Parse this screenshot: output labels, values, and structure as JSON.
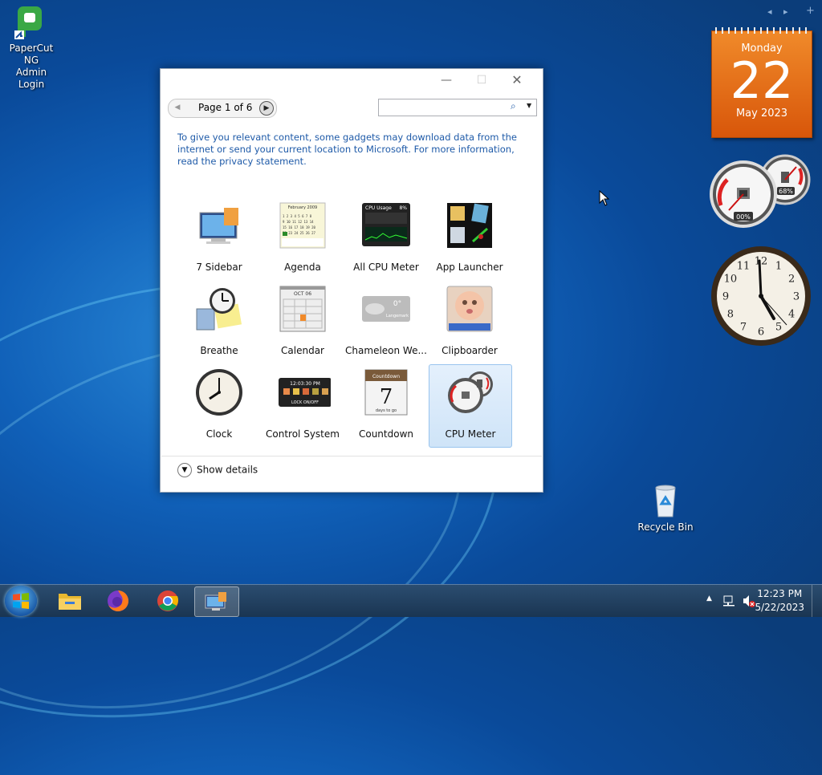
{
  "desktop": {
    "icons": [
      {
        "label_line1": "PaperCut NG",
        "label_line2": "Admin Login"
      },
      {
        "label_line1": "Recycle Bin"
      }
    ]
  },
  "calendar_gadget": {
    "day_name": "Monday",
    "day_number": "22",
    "month_year": "May 2023"
  },
  "cpu_gadget": {
    "cpu_percent": "00%",
    "mem_percent": "68%"
  },
  "clock_gadget": {
    "numerals": [
      "12",
      "1",
      "2",
      "3",
      "4",
      "5",
      "6",
      "7",
      "8",
      "9",
      "10",
      "11"
    ]
  },
  "gadget_window": {
    "page_label": "Page 1 of 6",
    "search_placeholder": "",
    "info_text": "To give you relevant content, some gadgets may download data from the internet or send your current location to Microsoft. For more information, read the privacy statement.",
    "gadgets": [
      {
        "name": "7 Sidebar",
        "icon": "sidebar-icon"
      },
      {
        "name": "Agenda",
        "icon": "agenda-icon"
      },
      {
        "name": "All CPU Meter",
        "icon": "cpu-usage-icon"
      },
      {
        "name": "App Launcher",
        "icon": "app-launcher-icon"
      },
      {
        "name": "Breathe",
        "icon": "breathe-icon"
      },
      {
        "name": "Calendar",
        "icon": "calendar-icon"
      },
      {
        "name": "Chameleon We...",
        "icon": "weather-icon"
      },
      {
        "name": "Clipboarder",
        "icon": "clipboarder-icon"
      },
      {
        "name": "Clock",
        "icon": "clock-icon"
      },
      {
        "name": "Control System",
        "icon": "control-system-icon"
      },
      {
        "name": "Countdown",
        "icon": "countdown-icon"
      },
      {
        "name": "CPU Meter",
        "icon": "cpu-meter-icon",
        "selected": true
      }
    ],
    "details_label": "Show details",
    "icon_texts": {
      "agenda_header": "February 2009",
      "cpu_title": "CPU Usage",
      "cpu_pct": "8%",
      "calendar_month": "OCT 06",
      "weather_temp": "0°",
      "weather_place": "Langemark",
      "control_time": "12:03:30 PM",
      "control_lock": "LOCK ON/OFF",
      "countdown_title": "Countdown",
      "countdown_num": "7",
      "countdown_sub": "days to go"
    }
  },
  "taskbar": {
    "time": "12:23 PM",
    "date": "5/22/2023"
  },
  "colors": {
    "calendar_orange": "#e86a10",
    "selection_blue": "#cfe4f8",
    "link_blue": "#1e5aa8"
  }
}
